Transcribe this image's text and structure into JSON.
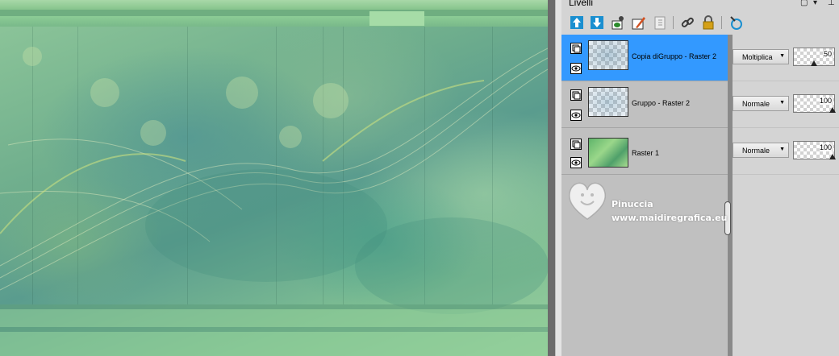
{
  "palette": {
    "title": "Livelli",
    "window_buttons": [
      "▢",
      "▾",
      "⊥"
    ]
  },
  "toolbar": {
    "tools": [
      {
        "name": "new-raster-layer-icon",
        "color": "#1a8fd0"
      },
      {
        "name": "new-vector-layer-icon",
        "color": "#1a8fd0"
      },
      {
        "name": "new-mask-layer-icon",
        "color": "#2a8a2a"
      },
      {
        "name": "new-adjustment-layer-icon",
        "color": "#d05020"
      },
      {
        "name": "delete-layer-icon",
        "color": "#9a9a9a"
      },
      {
        "name": "link-layers-icon",
        "color": "#3a3a3a"
      },
      {
        "name": "lock-transparency-icon",
        "color": "#d4a017"
      },
      {
        "name": "edit-selection-icon",
        "color": "#1a8fd0"
      }
    ]
  },
  "layers": [
    {
      "name": "Copia diGruppo - Raster 2",
      "blend": "Moltiplica",
      "opacity": "50",
      "selected": true
    },
    {
      "name": "Gruppo - Raster 2",
      "blend": "Normale",
      "opacity": "100",
      "selected": false
    },
    {
      "name": "Raster 1",
      "blend": "Normale",
      "opacity": "100",
      "selected": false
    }
  ],
  "watermark": {
    "line1": "Pinuccia",
    "line2": "www.maidiregrafica.eu"
  },
  "colors": {
    "selection": "#3399ff",
    "canvas_green": "#7fbf93"
  }
}
